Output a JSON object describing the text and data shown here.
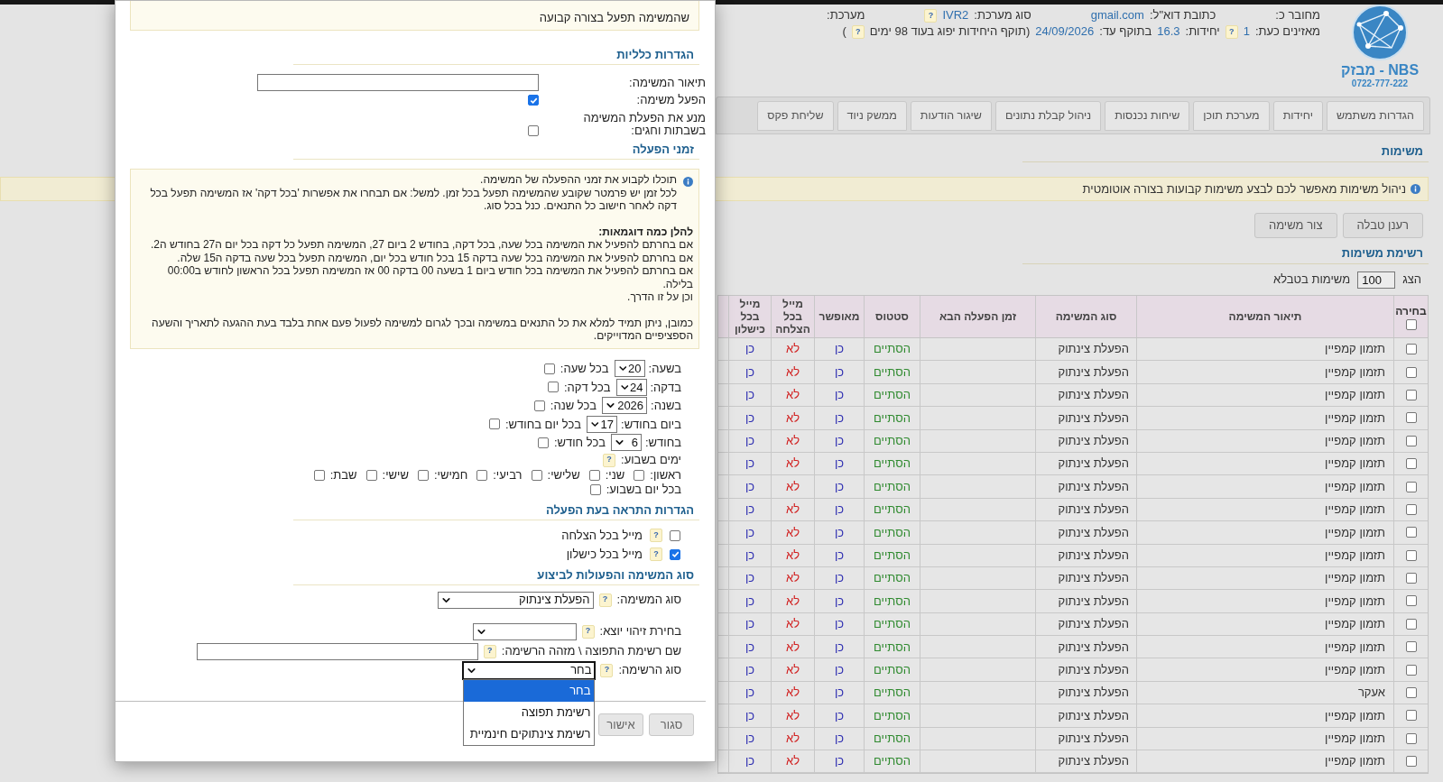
{
  "header": {
    "logo": {
      "name": "NBS - מבזק",
      "phone": "0722-777-222"
    },
    "lines": [
      [
        {
          "label": "מחובר כ:"
        },
        {
          "label": "כתובת דוא\"ל:",
          "value": "gmail.com"
        },
        {
          "label": "סוג מערכת:",
          "value": "IVR2",
          "help": "?"
        },
        {
          "label": "מערכת:"
        }
      ],
      [
        {
          "label": "מאזינים כעת:",
          "value": "1",
          "help": "?"
        },
        {
          "label": "יחידות:",
          "value": "16.3"
        },
        {
          "label": "בתוקף עד:",
          "value": "24/09/2026"
        },
        {
          "label": "(תוקף היחידות יפוג בעוד 98 ימים",
          "help": "?",
          "suffix": ")"
        }
      ]
    ]
  },
  "tabs": [
    "הגדרות משתמש",
    "יחידות",
    "מערכת תוכן",
    "שיחות נכנסות",
    "ניהול קבלת נתונים",
    "שיגור הודעות",
    "ממשק ניוד",
    "שליחת פקס"
  ],
  "page": {
    "title": "משימות",
    "banner": "ניהול משימות מאפשר לכם לבצע משימות קבועות בצורה אוטומטית",
    "buttons": [
      "רענן טבלה",
      "צור משימה"
    ],
    "list_title": "רשימת משימות",
    "show_label": "הצג",
    "show_value": "100",
    "show_suffix": "משימות בטבלא"
  },
  "table": {
    "select_all_checked": false,
    "columns": [
      "בחירה",
      "תיאור המשימה",
      "סוג המשימה",
      "זמן הפעלה הבא",
      "סטטוס",
      "מאופשר",
      "מייל בכל הצלחה",
      "מייל בכל כישלון"
    ],
    "rows": [
      {
        "selected": false,
        "description": "תזמון קמפיין",
        "type": "הפעלת צינתוק",
        "status": "הסתיים",
        "enabled": "כן",
        "mail_success": "לא",
        "mail_failure": "כן"
      },
      {
        "selected": false,
        "description": "תזמון קמפיין",
        "type": "הפעלת צינתוק",
        "status": "הסתיים",
        "enabled": "כן",
        "mail_success": "לא",
        "mail_failure": "כן"
      },
      {
        "selected": false,
        "description": "תזמון קמפיין",
        "type": "הפעלת צינתוק",
        "status": "הסתיים",
        "enabled": "כן",
        "mail_success": "לא",
        "mail_failure": "כן"
      },
      {
        "selected": false,
        "description": "תזמון קמפיין",
        "type": "הפעלת צינתוק",
        "status": "הסתיים",
        "enabled": "כן",
        "mail_success": "לא",
        "mail_failure": "כן"
      },
      {
        "selected": false,
        "description": "תזמון קמפיין",
        "type": "הפעלת צינתוק",
        "status": "הסתיים",
        "enabled": "כן",
        "mail_success": "לא",
        "mail_failure": "כן"
      },
      {
        "selected": false,
        "description": "תזמון קמפיין",
        "type": "הפעלת צינתוק",
        "status": "הסתיים",
        "enabled": "כן",
        "mail_success": "לא",
        "mail_failure": "כן"
      },
      {
        "selected": false,
        "description": "תזמון קמפיין",
        "type": "הפעלת צינתוק",
        "status": "הסתיים",
        "enabled": "כן",
        "mail_success": "לא",
        "mail_failure": "כן"
      },
      {
        "selected": false,
        "description": "תזמון קמפיין",
        "type": "הפעלת צינתוק",
        "status": "הסתיים",
        "enabled": "כן",
        "mail_success": "לא",
        "mail_failure": "כן"
      },
      {
        "selected": false,
        "description": "תזמון קמפיין",
        "type": "הפעלת צינתוק",
        "status": "הסתיים",
        "enabled": "כן",
        "mail_success": "לא",
        "mail_failure": "כן"
      },
      {
        "selected": false,
        "description": "תזמון קמפיין",
        "type": "הפעלת צינתוק",
        "status": "הסתיים",
        "enabled": "כן",
        "mail_success": "לא",
        "mail_failure": "כן"
      },
      {
        "selected": false,
        "description": "תזמון קמפיין",
        "type": "הפעלת צינתוק",
        "status": "הסתיים",
        "enabled": "כן",
        "mail_success": "לא",
        "mail_failure": "כן"
      },
      {
        "selected": false,
        "description": "תזמון קמפיין",
        "type": "הפעלת צינתוק",
        "status": "הסתיים",
        "enabled": "כן",
        "mail_success": "לא",
        "mail_failure": "כן"
      },
      {
        "selected": false,
        "description": "תזמון קמפיין",
        "type": "הפעלת צינתוק",
        "status": "הסתיים",
        "enabled": "כן",
        "mail_success": "לא",
        "mail_failure": "כן"
      },
      {
        "selected": false,
        "description": "תזמון קמפיין",
        "type": "הפעלת צינתוק",
        "status": "הסתיים",
        "enabled": "כן",
        "mail_success": "לא",
        "mail_failure": "כן"
      },
      {
        "selected": false,
        "description": "תזמון קמפיין",
        "type": "הפעלת צינתוק",
        "status": "הסתיים",
        "enabled": "כן",
        "mail_success": "לא",
        "mail_failure": "כן"
      },
      {
        "selected": false,
        "description": "אעקר",
        "type": "הפעלת צינתוק",
        "status": "הסתיים",
        "enabled": "כן",
        "mail_success": "לא",
        "mail_failure": "כן"
      },
      {
        "selected": false,
        "description": "תזמון קמפיין",
        "type": "הפעלת צינתוק",
        "status": "הסתיים",
        "enabled": "כן",
        "mail_success": "לא",
        "mail_failure": "כן"
      },
      {
        "selected": false,
        "description": "תזמון קמפיין",
        "type": "הפעלת צינתוק",
        "status": "הסתיים",
        "enabled": "כן",
        "mail_success": "לא",
        "mail_failure": "כן"
      },
      {
        "selected": false,
        "description": "תזמון קמפיין",
        "type": "הפעלת צינתוק",
        "status": "הסתיים",
        "enabled": "כן",
        "mail_success": "לא",
        "mail_failure": "כן"
      }
    ]
  },
  "modal": {
    "note": "שהמשימה תפעל בצורה קבועה",
    "general": {
      "title": "הגדרות כלליות",
      "description_label": "תיאור המשימה:",
      "activate_label": "הפעל משימה:",
      "activate_checked": true,
      "prevent_label": "מנע את הפעלת המשימה בשבתות וחגים:",
      "prevent_checked": false
    },
    "schedule": {
      "title": "זמני הפעלה",
      "info": {
        "lines": [
          "תוכלו לקבוע את זמני ההפעלה של המשימה.",
          "לכל זמן יש פרמטר שקובע שהמשימה תפעל בכל זמן. למשל: אם תבחרו את אפשרות 'בכל דקה' אז המשימה תפעל בכל דקה לאחר חישוב כל התנאים. כנל בכל סוג."
        ],
        "examples_title": "להלן כמה דוגמאות:",
        "examples": [
          "אם בחרתם להפעיל את המשימה בכל שעה, בכל דקה, בחודש 2 ביום 27, המשימה תפעל כל דקה בכל יום ה27 בחודש ה2.",
          "אם בחרתם להפעיל את המשימה בכל שעה בדקה 15 בכל חודש בכל יום, המשימה תפעל בכל שעה בדקה ה15 שלה.",
          "אם בחרתם להפעיל את המשימה בכל חודש ביום 1 בשעה 00 בדקה 00 אז המשימה תפעל בכל הראשון לחודש ב00:00 בלילה.",
          "וכן על זו הדרך."
        ],
        "closing": "כמובן, ניתן תמיד למלא את כל התנאים במשימה ובכך לגרום למשימה לפעול פעם אחת בלבד בעת ההגעה לתאריך והשעה הספציפיים המדוייקים."
      },
      "fields": [
        {
          "label": "בשעה:",
          "value": "20",
          "every_label": "בכל שעה:",
          "every_checked": false
        },
        {
          "label": "בדקה:",
          "value": "24",
          "every_label": "בכל דקה:",
          "every_checked": false
        },
        {
          "label": "בשנה:",
          "value": "2026",
          "every_label": "בכל שנה:",
          "every_checked": false
        },
        {
          "label": "ביום בחודש:",
          "value": "17",
          "every_label": "בכל יום בחודש:",
          "every_checked": false
        },
        {
          "label": "בחודש:",
          "value": "6",
          "every_label": "בכל חודש:",
          "every_checked": false
        }
      ],
      "days_label": "ימים בשבוע:",
      "days_help": "?",
      "days": [
        {
          "label": "ראשון:",
          "checked": false
        },
        {
          "label": "שני:",
          "checked": false
        },
        {
          "label": "שלישי:",
          "checked": false
        },
        {
          "label": "רביעי:",
          "checked": false
        },
        {
          "label": "חמישי:",
          "checked": false
        },
        {
          "label": "שישי:",
          "checked": false
        },
        {
          "label": "שבת:",
          "checked": false
        }
      ],
      "every_day_label": "בכל יום בשבוע:",
      "every_day_checked": false
    },
    "alerts": {
      "title": "הגדרות התראה בעת הפעלה",
      "items": [
        {
          "label": "מייל בכל הצלחה",
          "help": "?",
          "checked": false
        },
        {
          "label": "מייל בכל כישלון",
          "help": "?",
          "checked": true
        }
      ]
    },
    "task": {
      "title": "סוג המשימה והפעולות לביצוע",
      "fields": [
        {
          "kind": "select",
          "label": "סוג המשימה:",
          "help": "?",
          "value": "הפעלת צינתוק"
        },
        {
          "kind": "select",
          "label": "בחירת זיהוי יוצא:",
          "help": "?"
        },
        {
          "kind": "text",
          "label": "שם רשימת התפוצה \\ מזהה הרשימה:",
          "help": "?"
        },
        {
          "kind": "select",
          "label": "סוג הרשימה:",
          "help": "?",
          "value": "בחר",
          "expanded": true,
          "options": [
            {
              "label": "בחר",
              "selected": true
            },
            {
              "label": "רשימת תפוצה",
              "selected": false
            },
            {
              "label": "רשימת צינתוקים חינמיית",
              "selected": false
            }
          ]
        }
      ]
    },
    "buttons": [
      "סגור",
      "אישור"
    ]
  }
}
